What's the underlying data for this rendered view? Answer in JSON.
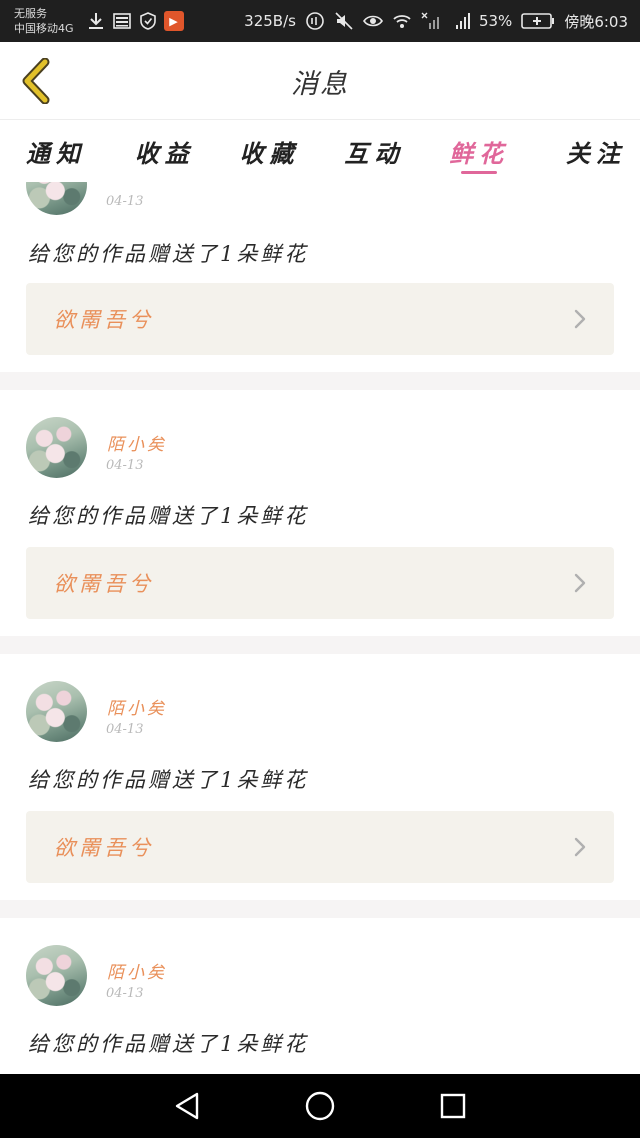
{
  "status_bar": {
    "no_service": "无服务",
    "carrier": "中国移动4G",
    "net_speed": "325B/s",
    "battery": "53%",
    "time": "傍晚6:03",
    "app_badge_glyph": "▶"
  },
  "header": {
    "title": "消息",
    "back_icon": "chevron-left-icon",
    "back_color": "#e2c12a"
  },
  "tabs": [
    {
      "label": "通知",
      "active": false
    },
    {
      "label": "收益",
      "active": false
    },
    {
      "label": "收藏",
      "active": false
    },
    {
      "label": "互动",
      "active": false
    },
    {
      "label": "鲜花",
      "active": true
    },
    {
      "label": "关注",
      "active": false
    }
  ],
  "accent_color": "#e0679a",
  "name_color": "#e9905a",
  "messages": [
    {
      "user": "",
      "date": "04-13",
      "text": "给您的作品赠送了1朵鲜花",
      "work": "欲罱吾兮"
    },
    {
      "user": "陌小矣",
      "date": "04-13",
      "text": "给您的作品赠送了1朵鲜花",
      "work": "欲罱吾兮"
    },
    {
      "user": "陌小矣",
      "date": "04-13",
      "text": "给您的作品赠送了1朵鲜花",
      "work": "欲罱吾兮"
    },
    {
      "user": "陌小矣",
      "date": "04-13",
      "text": "给您的作品赠送了1朵鲜花",
      "work": ""
    }
  ],
  "nav_bar": {
    "icons": [
      "back-triangle-icon",
      "home-circle-icon",
      "recents-square-icon"
    ]
  }
}
